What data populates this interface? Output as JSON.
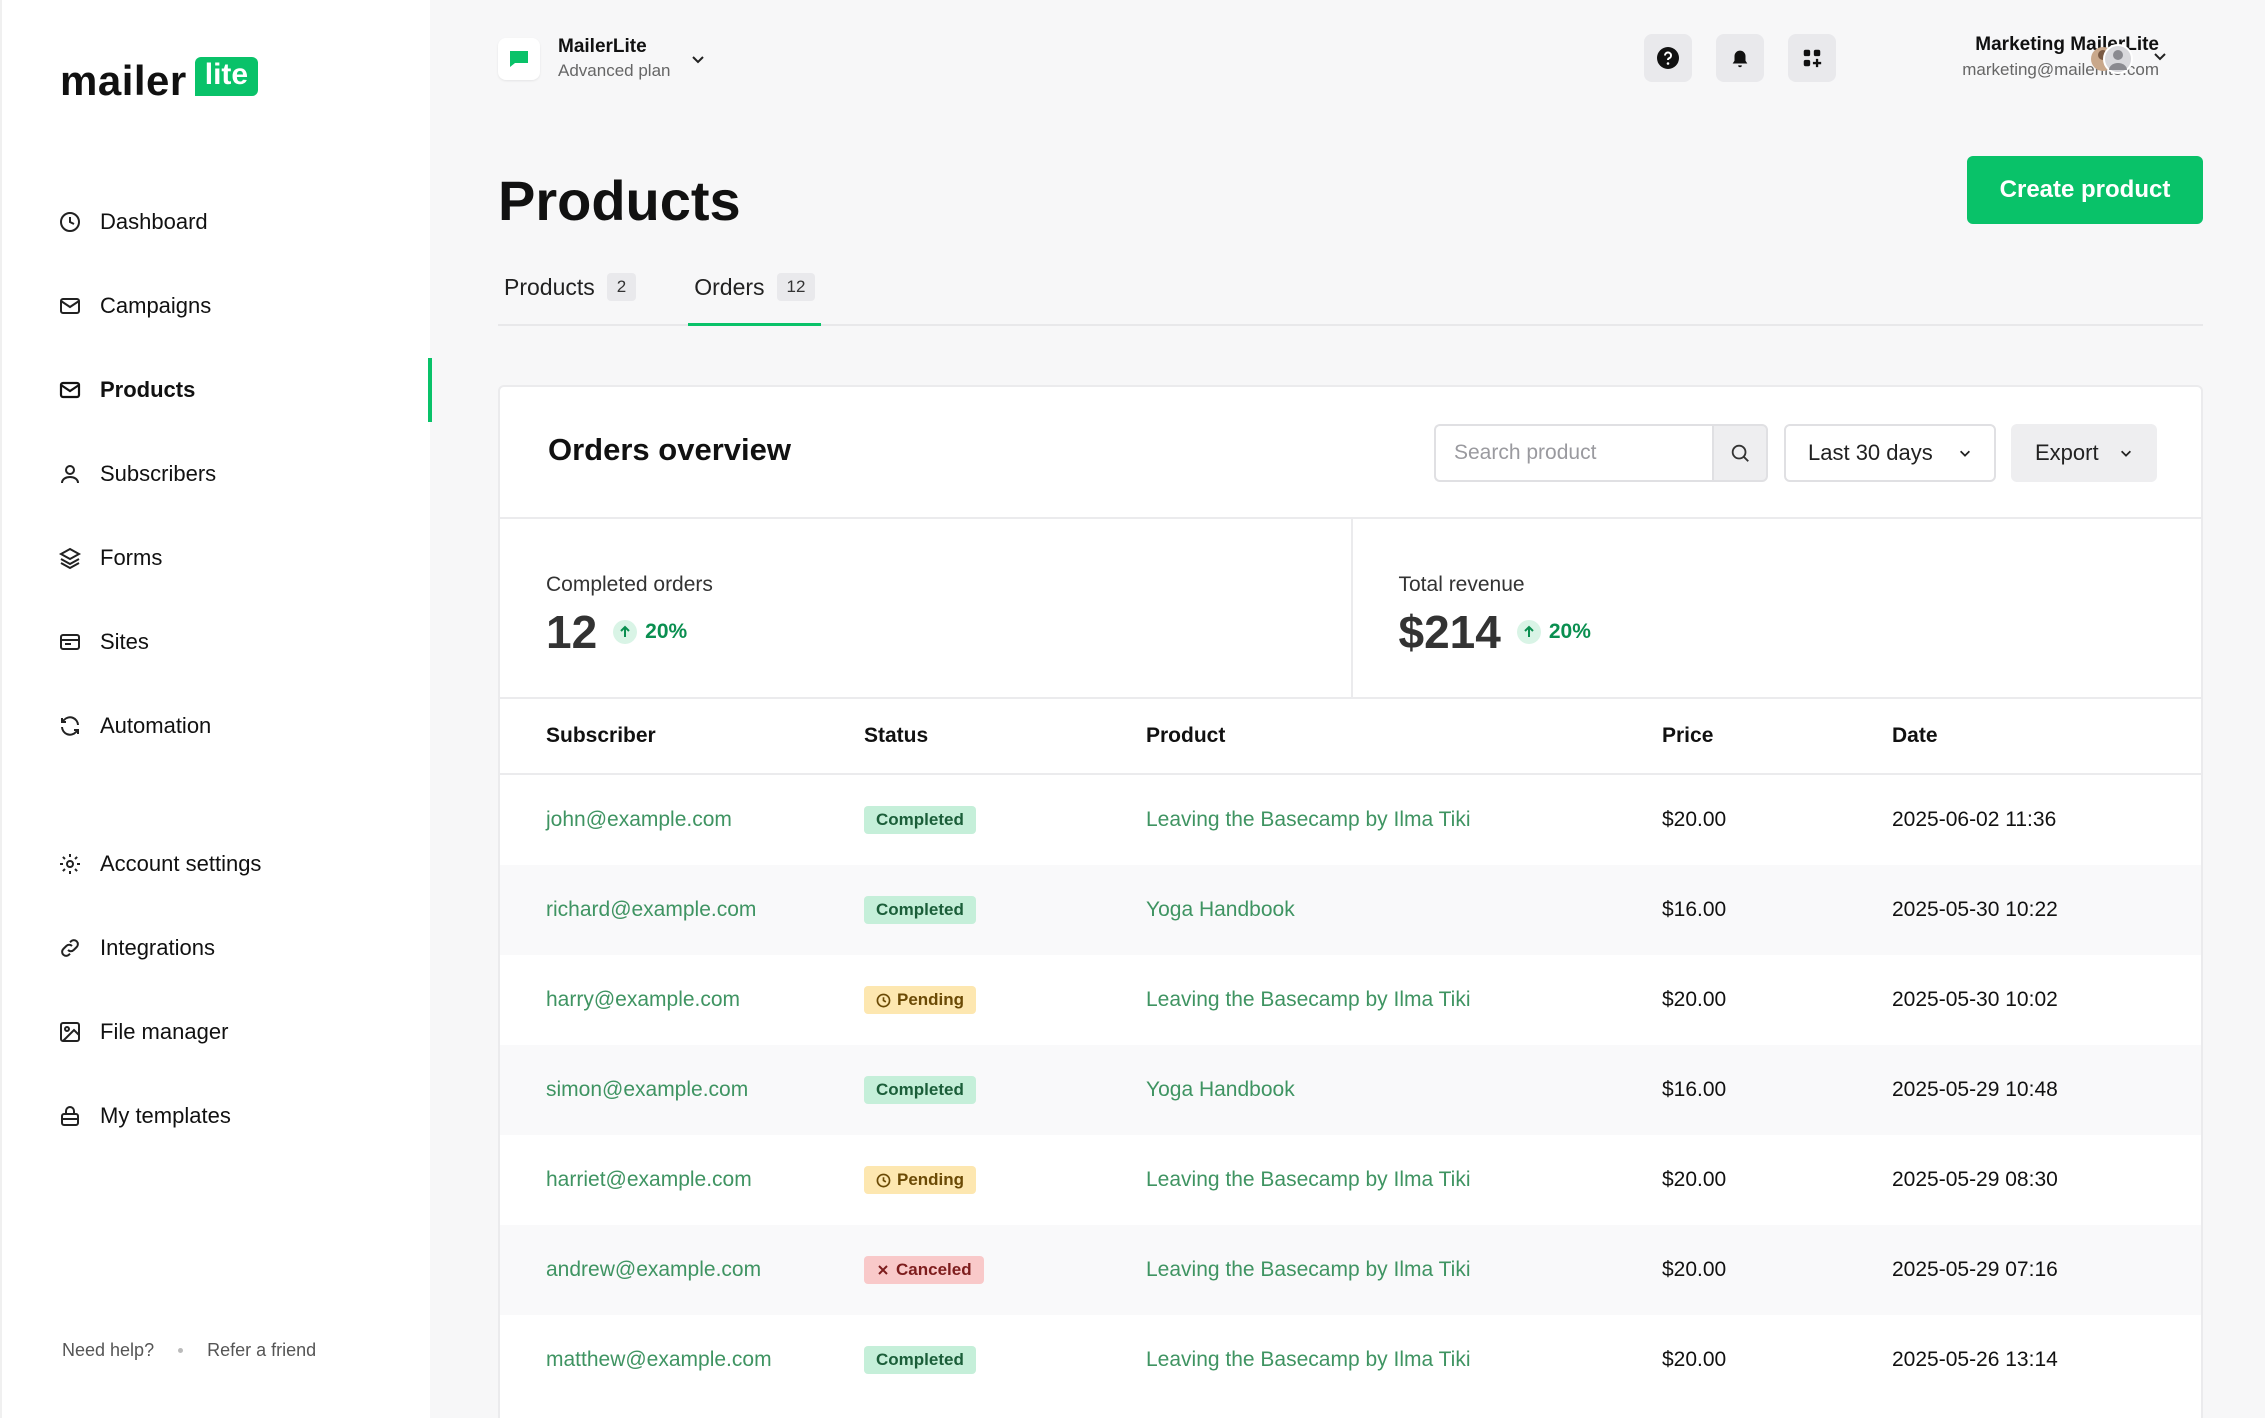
{
  "brand": {
    "logo_text": "mailer",
    "logo_badge": "lite"
  },
  "colors": {
    "accent": "#09c269",
    "link": "#3f9462"
  },
  "sidebar": {
    "items": [
      {
        "label": "Dashboard",
        "icon": "clock-icon"
      },
      {
        "label": "Campaigns",
        "icon": "mail-icon"
      },
      {
        "label": "Products",
        "icon": "mail-icon",
        "active": true
      },
      {
        "label": "Subscribers",
        "icon": "user-icon"
      },
      {
        "label": "Forms",
        "icon": "layers-icon"
      },
      {
        "label": "Sites",
        "icon": "browser-icon"
      },
      {
        "label": "Automation",
        "icon": "refresh-icon"
      }
    ],
    "secondary": [
      {
        "label": "Account settings",
        "icon": "gear-icon"
      },
      {
        "label": "Integrations",
        "icon": "link-icon"
      },
      {
        "label": "File manager",
        "icon": "image-icon"
      },
      {
        "label": "My templates",
        "icon": "lock-icon"
      }
    ],
    "footer": {
      "help": "Need help?",
      "refer": "Refer a friend"
    }
  },
  "account": {
    "name": "MailerLite",
    "plan": "Advanced plan"
  },
  "user": {
    "name": "Marketing MailerLite",
    "email": "marketing@mailerlite.com"
  },
  "page": {
    "title": "Products",
    "create_label": "Create product",
    "tabs": [
      {
        "label": "Products",
        "count": "2"
      },
      {
        "label": "Orders",
        "count": "12",
        "active": true
      }
    ]
  },
  "orders": {
    "title": "Orders overview",
    "search_placeholder": "Search product",
    "date_range": "Last 30 days",
    "export_label": "Export",
    "stats": [
      {
        "label": "Completed orders",
        "value": "12",
        "delta": "20%"
      },
      {
        "label": "Total revenue",
        "value": "$214",
        "delta": "20%"
      }
    ],
    "columns": [
      "Subscriber",
      "Status",
      "Product",
      "Price",
      "Date"
    ],
    "rows": [
      {
        "subscriber": "john@example.com",
        "status": "Completed",
        "product": "Leaving the Basecamp by Ilma Tiki",
        "price": "$20.00",
        "date": "2025-06-02 11:36"
      },
      {
        "subscriber": "richard@example.com",
        "status": "Completed",
        "product": "Yoga Handbook",
        "price": "$16.00",
        "date": "2025-05-30 10:22"
      },
      {
        "subscriber": "harry@example.com",
        "status": "Pending",
        "product": "Leaving the Basecamp by Ilma Tiki",
        "price": "$20.00",
        "date": "2025-05-30 10:02"
      },
      {
        "subscriber": "simon@example.com",
        "status": "Completed",
        "product": "Yoga Handbook",
        "price": "$16.00",
        "date": "2025-05-29 10:48"
      },
      {
        "subscriber": "harriet@example.com",
        "status": "Pending",
        "product": "Leaving the Basecamp by Ilma Tiki",
        "price": "$20.00",
        "date": "2025-05-29 08:30"
      },
      {
        "subscriber": "andrew@example.com",
        "status": "Canceled",
        "product": "Leaving the Basecamp by Ilma Tiki",
        "price": "$20.00",
        "date": "2025-05-29 07:16"
      },
      {
        "subscriber": "matthew@example.com",
        "status": "Completed",
        "product": "Leaving the Basecamp by Ilma Tiki",
        "price": "$20.00",
        "date": "2025-05-26 13:14"
      }
    ]
  }
}
